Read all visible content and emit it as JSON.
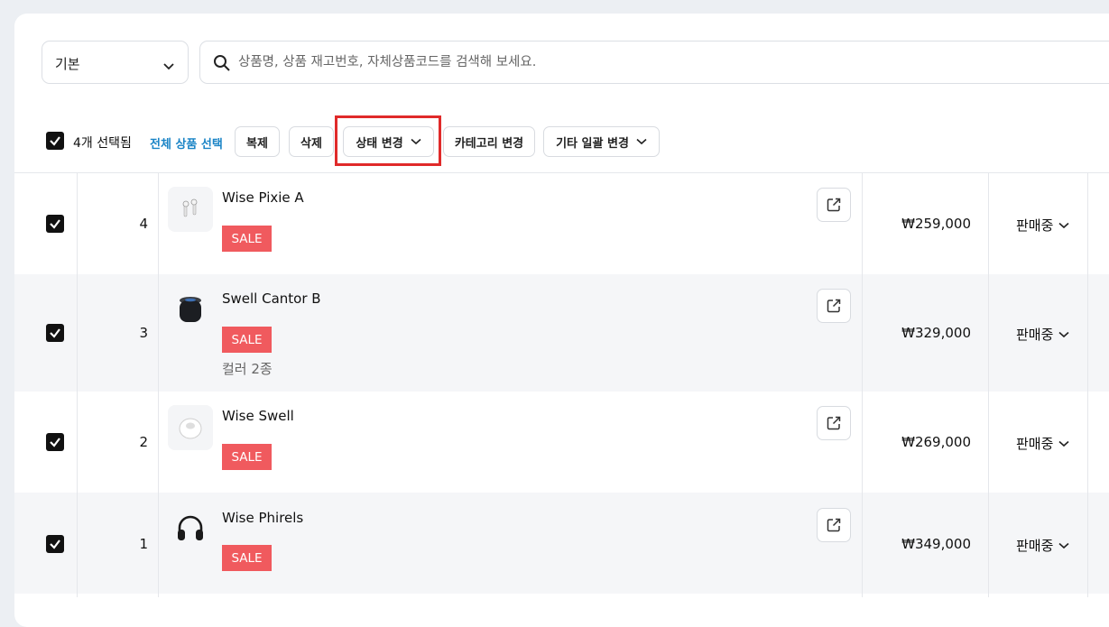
{
  "filter": {
    "view_select": "기본",
    "search_placeholder": "상품명, 상품 재고번호, 자체상품코드를 검색해 보세요."
  },
  "toolbar": {
    "selected_count": "4개 선택됨",
    "select_all": "전체 상품 선택",
    "copy": "복제",
    "delete": "삭제",
    "change_status": "상태 변경",
    "change_category": "카테고리 변경",
    "other_bulk_change": "기타 일괄 변경"
  },
  "colors": {
    "sale_badge": "#f05a5e",
    "link": "#1a84c6",
    "highlight": "#e02a2a"
  },
  "products": [
    {
      "number": "4",
      "name": "Wise Pixie A",
      "badge": "SALE",
      "price": "₩259,000",
      "status": "판매중",
      "icon": "earbuds-icon"
    },
    {
      "number": "3",
      "name": "Swell Cantor B",
      "badge": "SALE",
      "variant": "컬러 2종",
      "price": "₩329,000",
      "status": "판매중",
      "icon": "smart-speaker-icon"
    },
    {
      "number": "2",
      "name": "Wise Swell",
      "badge": "SALE",
      "price": "₩269,000",
      "status": "판매중",
      "icon": "mini-speaker-icon"
    },
    {
      "number": "1",
      "name": "Wise Phirels",
      "badge": "SALE",
      "price": "₩349,000",
      "status": "판매중",
      "icon": "headphones-icon"
    }
  ]
}
